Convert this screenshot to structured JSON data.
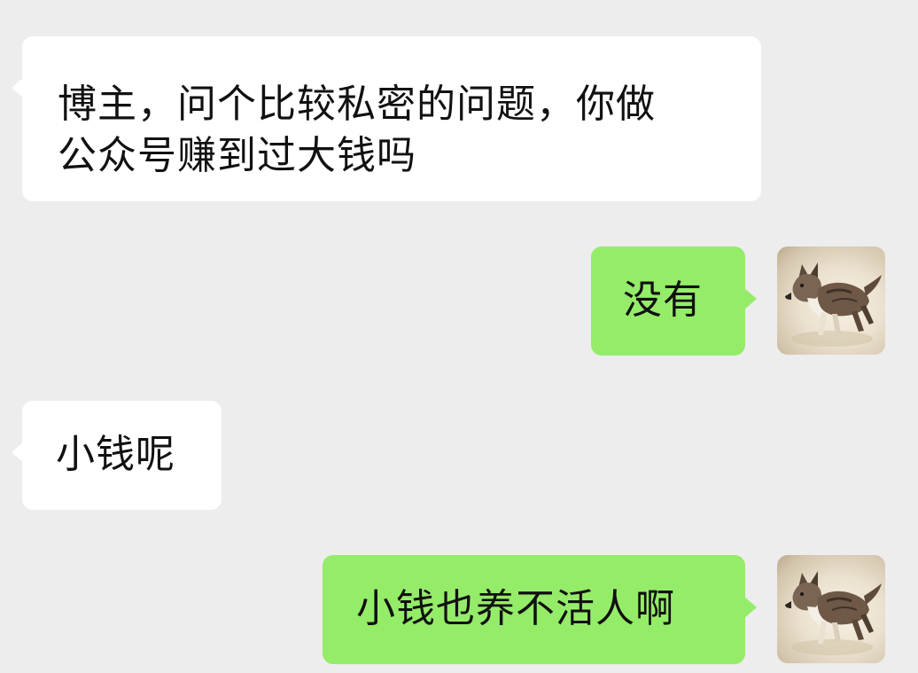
{
  "chat": {
    "background_color": "#ededed",
    "incoming_bubble_color": "#ffffff",
    "outgoing_bubble_color": "#95ec69",
    "messages": [
      {
        "direction": "incoming",
        "text": "博主，问个比较私密的问题，你做\n公众号赚到过大钱吗"
      },
      {
        "direction": "outgoing",
        "text": "没有",
        "avatar_icon": "wolf-dog-avatar"
      },
      {
        "direction": "incoming",
        "text": "小钱呢"
      },
      {
        "direction": "outgoing",
        "text": "小钱也养不活人啊",
        "avatar_icon": "wolf-dog-avatar"
      }
    ]
  }
}
